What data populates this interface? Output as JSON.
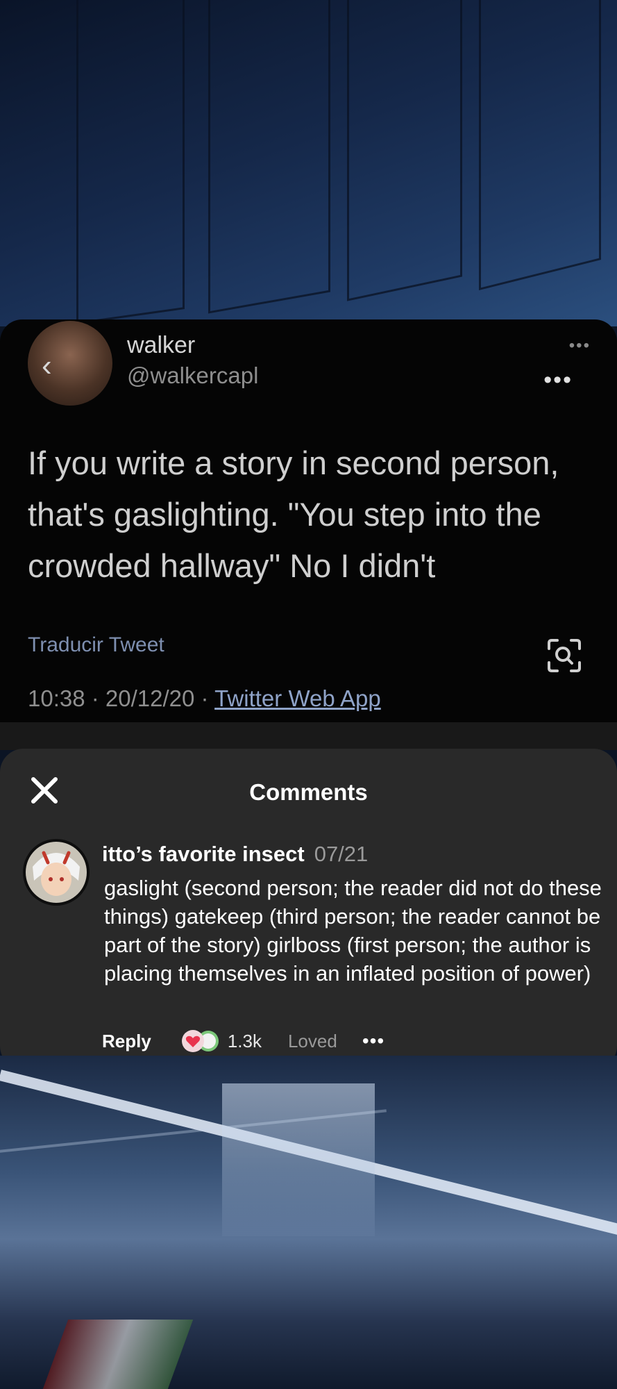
{
  "tweet": {
    "name": "walker",
    "handle": "@walkercapl",
    "text": "If you write a story in second person, that's gaslighting. \"You step into the crowded hallway\" No I didn't",
    "translate_label": "Traducir Tweet",
    "meta_time": "10:38 · 20/12/20 · ",
    "meta_source": "Twitter Web App",
    "menu_top": "•••",
    "menu": "•••",
    "back": "‹"
  },
  "comments": {
    "title": "Comments",
    "close": "✕",
    "items": [
      {
        "username": "itto’s favorite insect",
        "date": "07/21",
        "text": "gaslight (second person; the reader did not do these things) gatekeep (third person; the reader cannot be part of the story) girlboss (first person; the author is placing themselves in an inflated position of power)",
        "reply_label": "Reply",
        "likes": "1.3k",
        "status": "Loved",
        "more": "•••"
      }
    ]
  },
  "colors": {
    "panel_bg": "#292929",
    "tweet_bg": "#050505",
    "link_blue": "#8fa3c8",
    "heart_red": "#e8344e",
    "heart_green": "#7cc77a"
  },
  "icons": [
    "back-chevron-icon",
    "more-icon",
    "visual-search-icon",
    "close-icon",
    "heart-icon"
  ]
}
